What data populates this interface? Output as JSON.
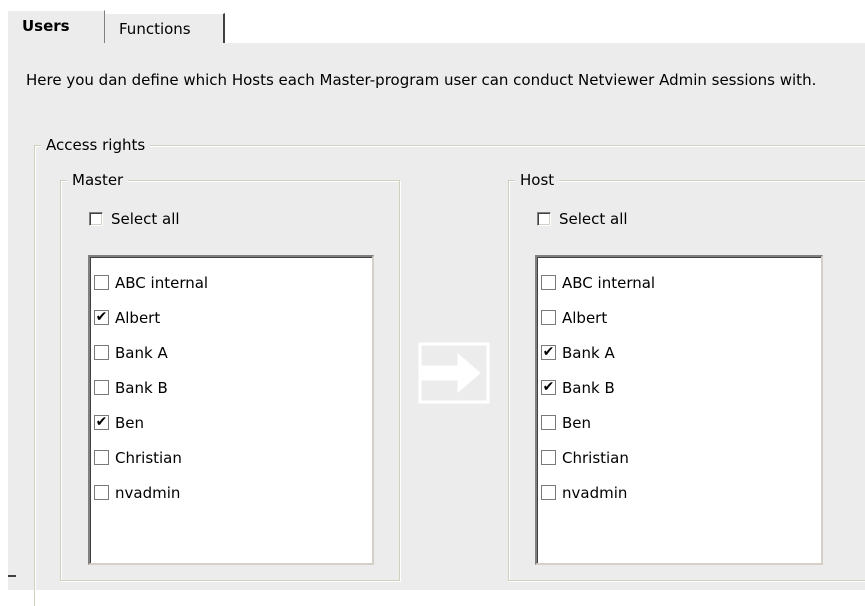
{
  "tabs": [
    {
      "label": "Users",
      "active": true
    },
    {
      "label": "Functions",
      "active": false
    }
  ],
  "description": "Here you dan define which Hosts each Master-program user can conduct Netviewer Admin sessions with.",
  "access": {
    "title": "Access rights",
    "master": {
      "title": "Master",
      "select_all_label": "Select all",
      "select_all_checked": false,
      "items": [
        {
          "label": "ABC internal",
          "checked": false
        },
        {
          "label": "Albert",
          "checked": true
        },
        {
          "label": "Bank A",
          "checked": false
        },
        {
          "label": "Bank B",
          "checked": false
        },
        {
          "label": "Ben",
          "checked": true
        },
        {
          "label": "Christian",
          "checked": false
        },
        {
          "label": "nvadmin",
          "checked": false
        }
      ]
    },
    "host": {
      "title": "Host",
      "select_all_label": "Select all",
      "select_all_checked": false,
      "items": [
        {
          "label": "ABC internal",
          "checked": false
        },
        {
          "label": "Albert",
          "checked": false
        },
        {
          "label": "Bank A",
          "checked": true
        },
        {
          "label": "Bank B",
          "checked": true
        },
        {
          "label": "Ben",
          "checked": false
        },
        {
          "label": "Christian",
          "checked": false
        },
        {
          "label": "nvadmin",
          "checked": false
        }
      ]
    }
  },
  "icons": {
    "assign": "arrow-right-icon",
    "checkmark": "✔"
  },
  "colors": {
    "panel": "#ececec",
    "arrow": "#ffffff"
  }
}
